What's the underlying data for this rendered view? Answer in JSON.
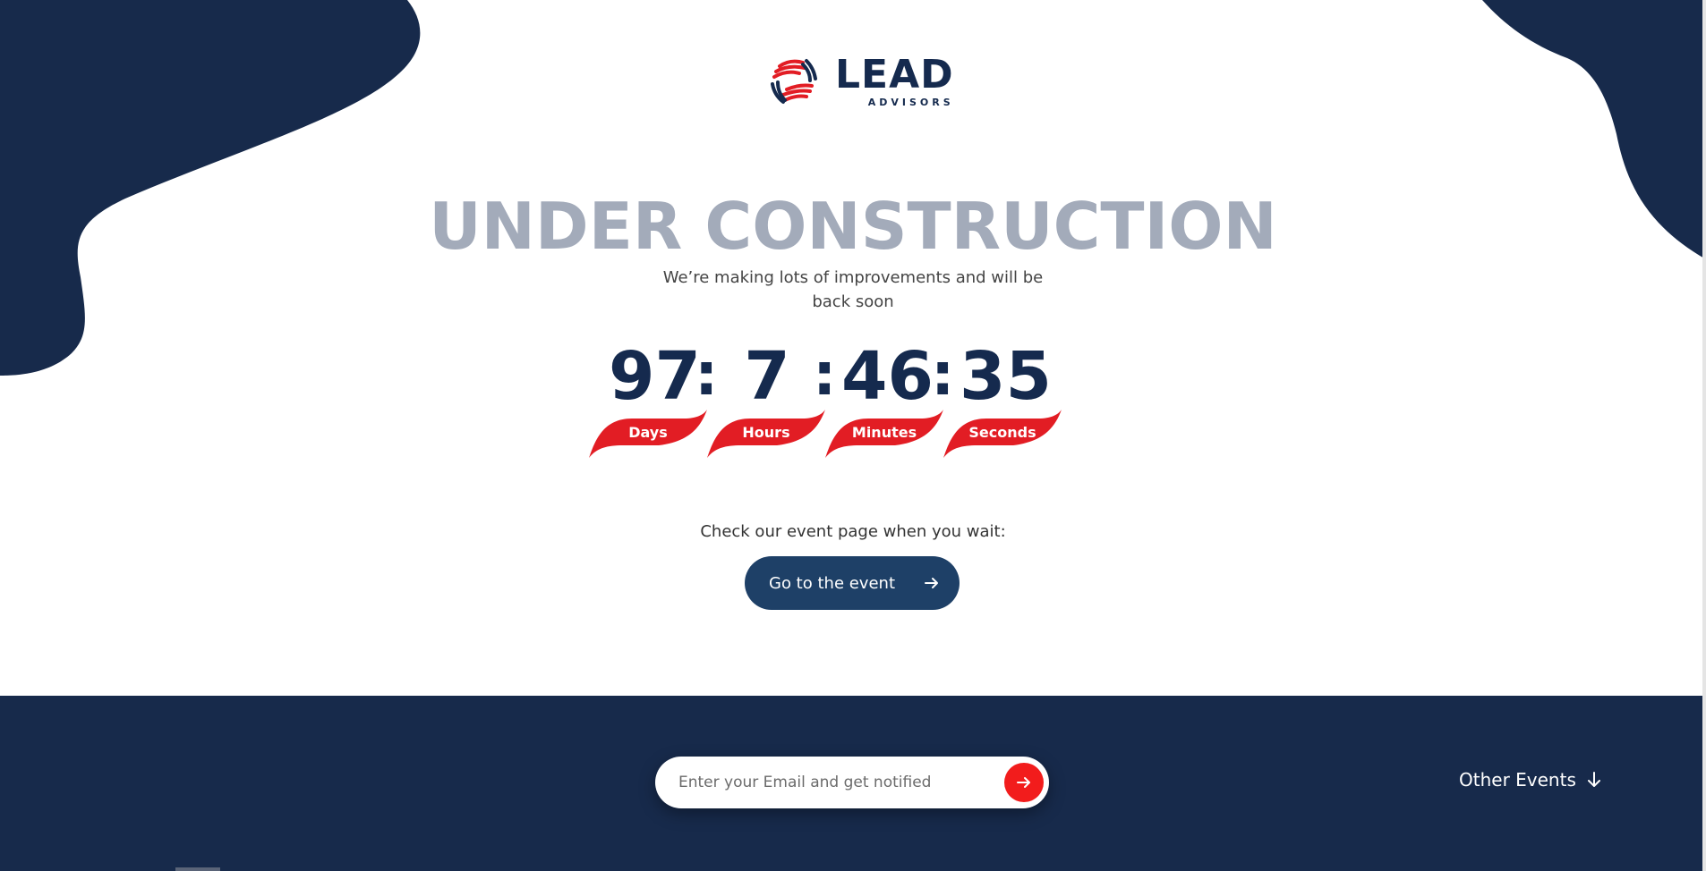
{
  "colors": {
    "navy": "#172a4b",
    "button_blue": "#1e4067",
    "accent_red": "#e21d24",
    "headline_gray": "#a3abba"
  },
  "logo": {
    "name": "LEAD",
    "sub": "ADVISORS",
    "icon": "lead-advisors-logo-icon"
  },
  "hero": {
    "title": "UNDER CONSTRUCTION",
    "subtitle": "We’re making lots of improvements and will be back soon"
  },
  "countdown": {
    "days": "97",
    "hours": "7",
    "minutes": "46",
    "seconds": "35",
    "separator": ":",
    "labels": {
      "days": "Days",
      "hours": "Hours",
      "minutes": "Minutes",
      "seconds": "Seconds"
    }
  },
  "event": {
    "prompt": "Check our event page when you wait:",
    "button_label": "Go to the event",
    "button_icon": "arrow-right-icon"
  },
  "footer": {
    "email_placeholder": "Enter your Email and get notified",
    "submit_icon": "arrow-right-icon",
    "other_events_label": "Other Events",
    "other_events_icon": "arrow-down-icon"
  }
}
